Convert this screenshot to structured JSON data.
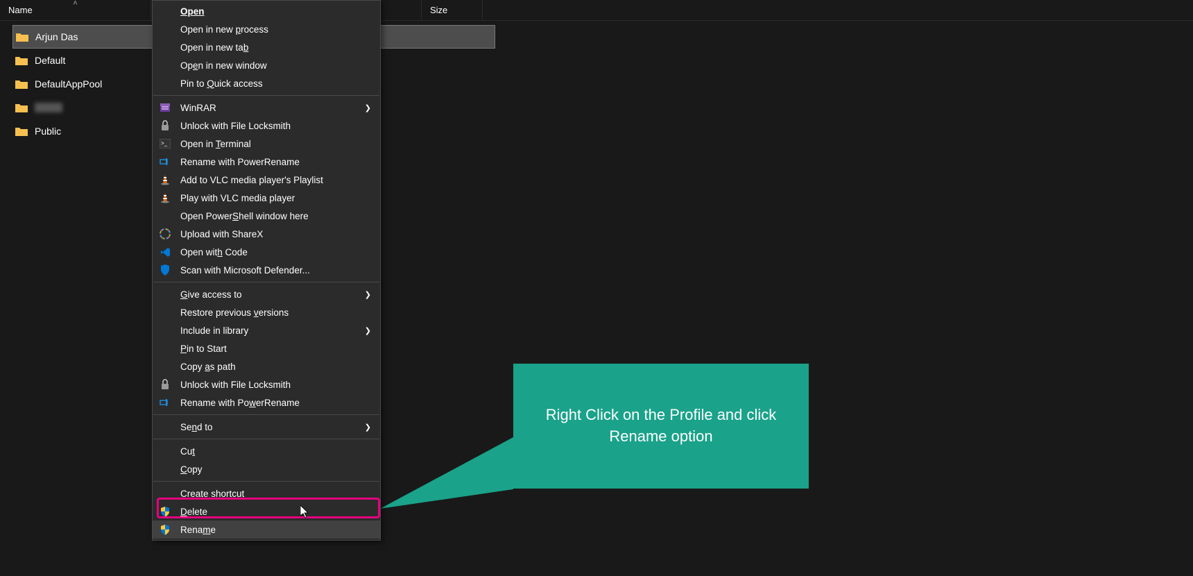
{
  "columns": {
    "name": "Name",
    "size": "Size"
  },
  "folders": [
    {
      "name": "Arjun Das",
      "selected": true
    },
    {
      "name": "Default",
      "selected": false
    },
    {
      "name": "DefaultAppPool",
      "selected": false
    },
    {
      "name": "",
      "selected": false,
      "blurred": true
    },
    {
      "name": "Public",
      "selected": false
    }
  ],
  "menu": {
    "open": "Open",
    "open_new_process": {
      "pre": "Open in new ",
      "u": "p",
      "post": "rocess"
    },
    "open_new_tab": {
      "pre": "Open in new ta",
      "u": "b",
      "post": ""
    },
    "open_new_window": {
      "pre": "Op",
      "u": "e",
      "post": "n in new window"
    },
    "pin_quick": {
      "pre": "Pin to ",
      "u": "Q",
      "post": "uick access"
    },
    "winrar": "WinRAR",
    "unlock_locksmith": "Unlock with File Locksmith",
    "open_terminal": {
      "pre": "Open in ",
      "u": "T",
      "post": "erminal"
    },
    "rename_powerrename": "Rename with PowerRename",
    "add_vlc": "Add to VLC media player's Playlist",
    "play_vlc": "Play with VLC media player",
    "open_powershell": {
      "pre": "Open Power",
      "u": "S",
      "post": "hell window here"
    },
    "upload_sharex": "Upload with ShareX",
    "open_code": {
      "pre": "Open wit",
      "u": "h",
      "post": " Code"
    },
    "scan_defender": "Scan with Microsoft Defender...",
    "give_access": {
      "pre": "",
      "u": "G",
      "post": "ive access to"
    },
    "restore_versions": {
      "pre": "Restore previous ",
      "u": "v",
      "post": "ersions"
    },
    "include_library": "Include in library",
    "pin_start": {
      "pre": "",
      "u": "P",
      "post": "in to Start"
    },
    "copy_as_path": {
      "pre": "Copy ",
      "u": "a",
      "post": "s path"
    },
    "unlock_locksmith2": "Unlock with File Locksmith",
    "rename_powerrename2": {
      "pre": "Rename with Po",
      "u": "w",
      "post": "erRename"
    },
    "send_to": {
      "pre": "Se",
      "u": "n",
      "post": "d to"
    },
    "cut": {
      "pre": "Cu",
      "u": "t",
      "post": ""
    },
    "copy": {
      "pre": "",
      "u": "C",
      "post": "opy"
    },
    "create_shortcut": {
      "pre": "Create ",
      "u": "s",
      "post": "hortcut"
    },
    "delete": {
      "pre": "",
      "u": "D",
      "post": "elete"
    },
    "rename": {
      "pre": "Rena",
      "u": "m",
      "post": "e"
    }
  },
  "callout": "Right Click on the Profile and click Rename option"
}
